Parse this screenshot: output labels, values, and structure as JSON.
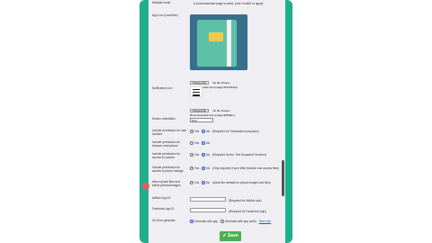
{
  "top_row": {
    "label": "Website mode",
    "value": "A (recommended page is used). (Use 'mobile' to apply)"
  },
  "app_icon": {
    "label": "App icon (Launcher)",
    "choose": "Choose File",
    "no_file": "No file chosen",
    "hint": "Recommended size (image 512x512px)"
  },
  "notif_icon": {
    "label": "Notification icon",
    "choose": "Choose File",
    "no_file": "No file chosen",
    "hint": "Recommended size (image 96x96px)"
  },
  "screen_orientation": {
    "label": "Screen orientation",
    "value": "Both"
  },
  "perm_location": {
    "label": "Include permission for user location",
    "opts": [
      "Yes",
      "No"
    ],
    "note": "(Required for Geolocation purposes)"
  },
  "perm_microphone": {
    "label": "Include permission for browser microphone",
    "opts": [
      "Yes",
      "No"
    ]
  },
  "perm_camera": {
    "label": "Include permission for access to camera",
    "opts": [
      "Yes",
      "No"
    ],
    "note": "(Required for the \"Get Snapshot\" function)"
  },
  "perm_storage": {
    "label": "Include permission for access to phone storage",
    "opts": [
      "Yes",
      "No"
    ],
    "note": "(Only required if your Web function can access files)"
  },
  "allow_files": {
    "label": "Allow upload files and select pictures/images",
    "opts": [
      "Yes",
      "No"
    ],
    "note": "(Allow the website to upload images and files)"
  },
  "admob": {
    "label": "AdMob App ID",
    "placeholder": "",
    "note": "(Required for AdMob ads)"
  },
  "facebook": {
    "label": "Facebook App ID",
    "placeholder": "",
    "note": "(Required for Facebook login)"
  },
  "on_error": {
    "label": "On Error generate",
    "opts": [
      "Generate with app",
      "Generate with app (web)"
    ],
    "link": "More info"
  },
  "save_label": "Save",
  "colors": {
    "phone": "#1fae8e",
    "save": "#4caf50",
    "radio": "#2255cc"
  }
}
